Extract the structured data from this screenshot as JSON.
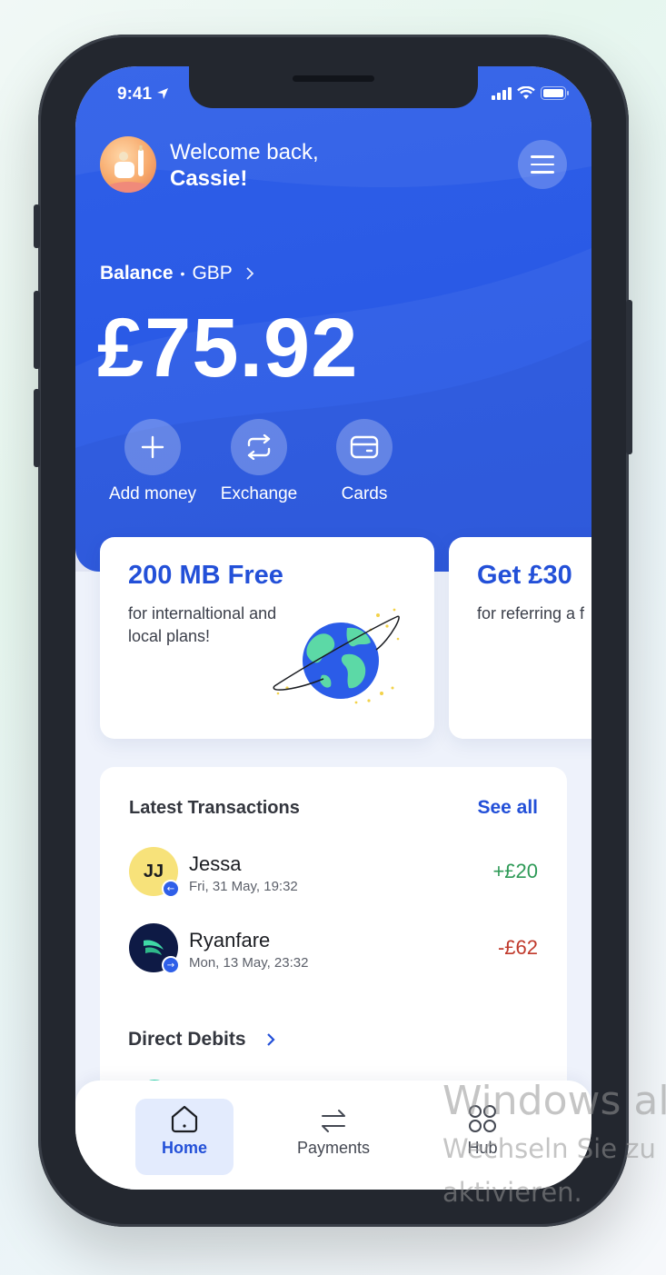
{
  "status": {
    "time": "9:41"
  },
  "header": {
    "greeting": "Welcome back,",
    "name": "Cassie!"
  },
  "balance": {
    "label": "Balance",
    "separator": "•",
    "currency": "GBP",
    "amount": "£75.92"
  },
  "actions": [
    {
      "label": "Add money",
      "icon": "plus-icon"
    },
    {
      "label": "Exchange",
      "icon": "exchange-icon"
    },
    {
      "label": "Cards",
      "icon": "card-icon"
    }
  ],
  "promos": [
    {
      "title": "200 MB Free",
      "line1": "for internaltional and",
      "line2": "local plans!"
    },
    {
      "title": "Get £30",
      "line1": "for referring a f",
      "line2": ""
    }
  ],
  "transactions": {
    "heading": "Latest Transactions",
    "see_all": "See all",
    "items": [
      {
        "initials": "JJ",
        "name": "Jessa",
        "date": "Fri, 31 May, 19:32",
        "amount": "+£20",
        "color": "#2e9a57"
      },
      {
        "initials": "",
        "name": "Ryanfare",
        "date": "Mon, 13 May, 23:32",
        "amount": "-£62",
        "color": "#c0392b"
      }
    ]
  },
  "direct_debits": {
    "heading": "Direct Debits"
  },
  "tabbar": {
    "tabs": [
      {
        "label": "Home",
        "icon": "home-icon"
      },
      {
        "label": "Payments",
        "icon": "transfer-icon"
      },
      {
        "label": "Hub",
        "icon": "grid-icon"
      }
    ]
  },
  "watermark": {
    "line1": "Windows al",
    "line2": "Wechseln Sie zu",
    "line3": "aktivieren."
  },
  "colors": {
    "primary": "#2f5fe8",
    "accent_text": "#2350d8",
    "positive": "#2e9a57",
    "negative": "#c0392b"
  }
}
